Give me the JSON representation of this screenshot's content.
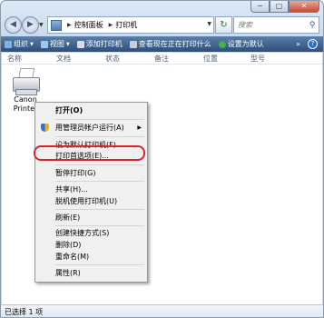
{
  "window": {
    "controls": {
      "minimize": "─",
      "maximize": "▢",
      "close": "✕"
    }
  },
  "address_bar": {
    "back_glyph": "◀",
    "forward_glyph": "▶",
    "segments": [
      "控制面板",
      "打印机"
    ],
    "refresh_glyph": "↻",
    "search_placeholder": "搜索"
  },
  "toolbar": {
    "items": [
      {
        "label": "组织",
        "icon": "organize-icon",
        "color": "#7fb3e8",
        "dropdown": true
      },
      {
        "label": "视图",
        "icon": "views-icon",
        "color": "#9ec7f0",
        "dropdown": true
      },
      {
        "label": "添加打印机",
        "icon": "add-printer-icon",
        "color": "#d7dde6",
        "dropdown": false
      },
      {
        "label": "查看现在正在打印什么",
        "icon": "print-queue-icon",
        "color": "#c9ced6",
        "dropdown": false
      },
      {
        "label": "设置为默认",
        "icon": "default-check-icon",
        "color": "#46b04a",
        "dropdown": false
      }
    ],
    "more": "»",
    "help": "?"
  },
  "columns": [
    "名称",
    "文档",
    "状态",
    "备注",
    "位置",
    "型号"
  ],
  "printer": {
    "label_line1": "Canon",
    "label_line2": "Printer"
  },
  "context_menu": {
    "items": [
      {
        "label": "打开(O)",
        "bold": true
      },
      {
        "label": "用管理员帐户运行(A)",
        "shield": true,
        "submenu": true
      },
      {
        "label": "设为默认打印机(F)"
      },
      {
        "label": "打印首选项(E)...",
        "highlighted": true
      },
      {
        "label": "暂停打印(G)"
      },
      {
        "label": "共享(H)..."
      },
      {
        "label": "脱机使用打印机(U)"
      },
      {
        "label": "刷新(E)"
      },
      {
        "label": "创建快捷方式(S)"
      },
      {
        "label": "删除(D)"
      },
      {
        "label": "重命名(M)"
      },
      {
        "label": "属性(R)"
      }
    ]
  },
  "status_bar": {
    "text": "已选择 1 项"
  },
  "colors": {
    "highlight_ring": "#d9232d",
    "toolbar_bg": "#2d4f7a"
  }
}
